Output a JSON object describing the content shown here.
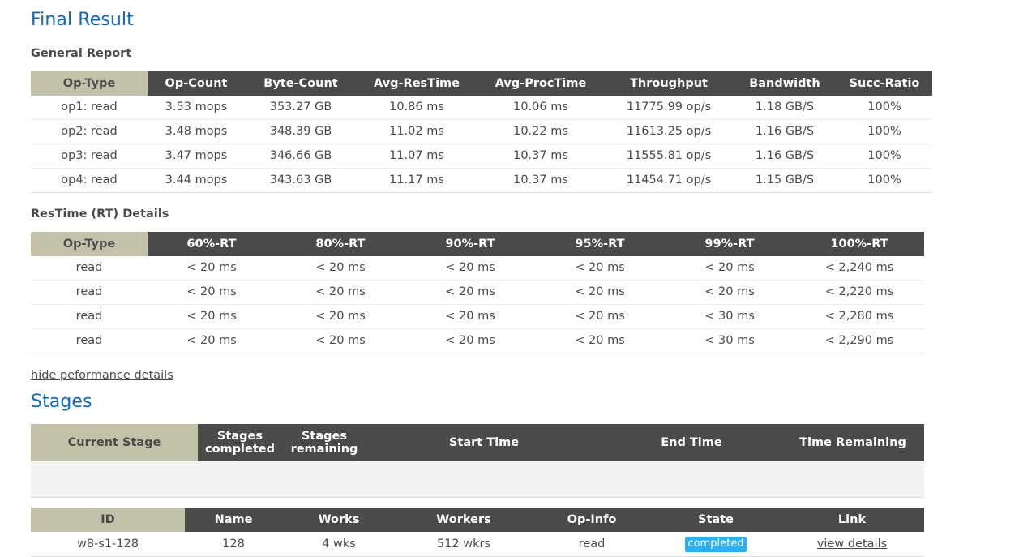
{
  "headings": {
    "final_result": "Final Result",
    "general_report": "General Report",
    "restime_details": "ResTime (RT) Details",
    "stages": "Stages"
  },
  "links": {
    "hide_performance_details": "hide peformance details",
    "view_details": "view details"
  },
  "colors": {
    "heading_blue": "#1468b3",
    "header_dark": "#4a4a48",
    "header_sage": "#c3c1a9",
    "badge_blue": "#29b0f7",
    "empty_row_gray": "#f2f2f2",
    "text": "#4a4a4a"
  },
  "general_report": {
    "columns": [
      "Op-Type",
      "Op-Count",
      "Byte-Count",
      "Avg-ResTime",
      "Avg-ProcTime",
      "Throughput",
      "Bandwidth",
      "Succ-Ratio"
    ],
    "rows": [
      [
        "op1: read",
        "3.53 mops",
        "353.27 GB",
        "10.86 ms",
        "10.06 ms",
        "11775.99 op/s",
        "1.18 GB/S",
        "100%"
      ],
      [
        "op2: read",
        "3.48 mops",
        "348.39 GB",
        "11.02 ms",
        "10.22 ms",
        "11613.25 op/s",
        "1.16 GB/S",
        "100%"
      ],
      [
        "op3: read",
        "3.47 mops",
        "346.66 GB",
        "11.07 ms",
        "10.37 ms",
        "11555.81 op/s",
        "1.16 GB/S",
        "100%"
      ],
      [
        "op4: read",
        "3.44 mops",
        "343.63 GB",
        "11.17 ms",
        "10.37 ms",
        "11454.71 op/s",
        "1.15 GB/S",
        "100%"
      ]
    ]
  },
  "restime_details": {
    "columns": [
      "Op-Type",
      "60%-RT",
      "80%-RT",
      "90%-RT",
      "95%-RT",
      "99%-RT",
      "100%-RT"
    ],
    "rows": [
      [
        "read",
        "< 20 ms",
        "< 20 ms",
        "< 20 ms",
        "< 20 ms",
        "< 20 ms",
        "< 2,240 ms"
      ],
      [
        "read",
        "< 20 ms",
        "< 20 ms",
        "< 20 ms",
        "< 20 ms",
        "< 20 ms",
        "< 2,220 ms"
      ],
      [
        "read",
        "< 20 ms",
        "< 20 ms",
        "< 20 ms",
        "< 20 ms",
        "< 30 ms",
        "< 2,280 ms"
      ],
      [
        "read",
        "< 20 ms",
        "< 20 ms",
        "< 20 ms",
        "< 20 ms",
        "< 30 ms",
        "< 2,290 ms"
      ]
    ]
  },
  "stages_summary": {
    "columns": [
      "Current Stage",
      "Stages completed",
      "Stages remaining",
      "Start Time",
      "End Time",
      "Time Remaining"
    ],
    "rows": [
      [
        "",
        "",
        "",
        "",
        "",
        ""
      ]
    ]
  },
  "stages_detail": {
    "columns": [
      "ID",
      "Name",
      "Works",
      "Workers",
      "Op-Info",
      "State",
      "Link"
    ],
    "rows": [
      {
        "id": "w8-s1-128",
        "name": "128",
        "works": "4 wks",
        "workers": "512 wkrs",
        "op_info": "read",
        "state": "completed",
        "link": "view details"
      }
    ]
  }
}
